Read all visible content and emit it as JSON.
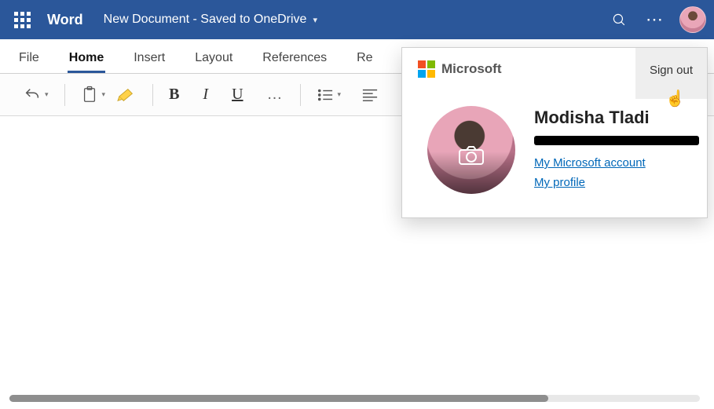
{
  "header": {
    "app_name": "Word",
    "doc_title": "New Document  -  Saved to OneDrive"
  },
  "tabs": {
    "items": [
      "File",
      "Home",
      "Insert",
      "Layout",
      "References",
      "Re"
    ],
    "active_index": 1
  },
  "toolbar": {
    "undo": "undo-icon",
    "paste": "clipboard-icon",
    "clear_formatting": "clear-formatting-icon",
    "bold": "B",
    "italic": "I",
    "underline": "U",
    "more": "…",
    "bullets": "bulleted-list-icon",
    "align": "align-left-icon"
  },
  "account_flyout": {
    "brand": "Microsoft",
    "sign_out": "Sign out",
    "user_name": "Modisha Tladi",
    "email_redacted": true,
    "link_account": "My Microsoft account",
    "link_profile": "My profile"
  },
  "colors": {
    "brand_blue": "#185abd",
    "link_blue": "#0067b8"
  }
}
